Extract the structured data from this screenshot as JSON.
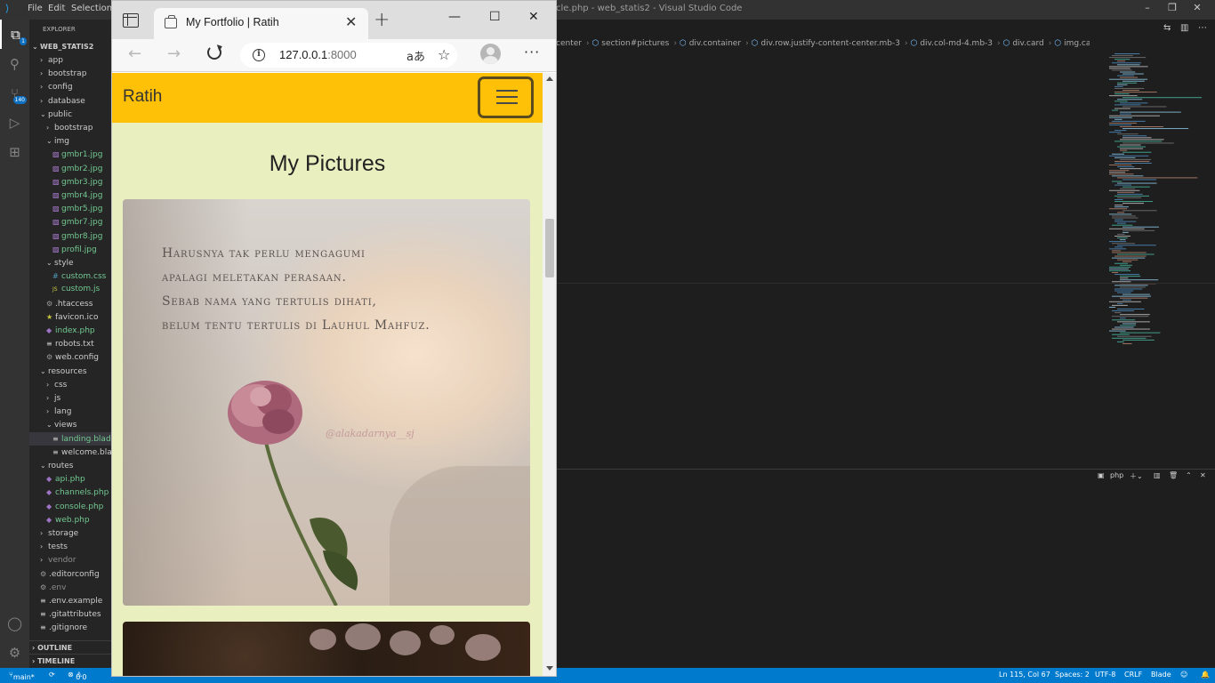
{
  "vscode": {
    "menu": [
      "File",
      "Edit",
      "Selection"
    ],
    "window_title": "cle.php - web_statis2 - Visual Studio Code",
    "explorer_header": "EXPLORER",
    "source_control_badge": "140",
    "explorer_badge": "1",
    "root": "WEB_STATIS2",
    "tree": [
      {
        "label": "app",
        "depth": 1,
        "type": "folder",
        "open": false
      },
      {
        "label": "bootstrap",
        "depth": 1,
        "type": "folder",
        "open": false
      },
      {
        "label": "config",
        "depth": 1,
        "type": "folder",
        "open": false
      },
      {
        "label": "database",
        "depth": 1,
        "type": "folder",
        "open": false
      },
      {
        "label": "public",
        "depth": 1,
        "type": "folder",
        "open": true
      },
      {
        "label": "bootstrap",
        "depth": 2,
        "type": "folder",
        "open": false
      },
      {
        "label": "img",
        "depth": 2,
        "type": "folder",
        "open": true
      },
      {
        "label": "gmbr1.jpg",
        "depth": 3,
        "type": "img"
      },
      {
        "label": "gmbr2.jpg",
        "depth": 3,
        "type": "img"
      },
      {
        "label": "gmbr3.jpg",
        "depth": 3,
        "type": "img"
      },
      {
        "label": "gmbr4.jpg",
        "depth": 3,
        "type": "img"
      },
      {
        "label": "gmbr5.jpg",
        "depth": 3,
        "type": "img"
      },
      {
        "label": "gmbr7.jpg",
        "depth": 3,
        "type": "img"
      },
      {
        "label": "gmbr8.jpg",
        "depth": 3,
        "type": "img"
      },
      {
        "label": "profil.jpg",
        "depth": 3,
        "type": "img"
      },
      {
        "label": "style",
        "depth": 2,
        "type": "folder",
        "open": true
      },
      {
        "label": "custom.css",
        "depth": 3,
        "type": "css"
      },
      {
        "label": "custom.js",
        "depth": 3,
        "type": "js"
      },
      {
        "label": ".htaccess",
        "depth": 2,
        "type": "gear"
      },
      {
        "label": "favicon.ico",
        "depth": 2,
        "type": "star"
      },
      {
        "label": "index.php",
        "depth": 2,
        "type": "php"
      },
      {
        "label": "robots.txt",
        "depth": 2,
        "type": "txt"
      },
      {
        "label": "web.config",
        "depth": 2,
        "type": "gear"
      },
      {
        "label": "resources",
        "depth": 1,
        "type": "folder",
        "open": true
      },
      {
        "label": "css",
        "depth": 2,
        "type": "folder",
        "open": false
      },
      {
        "label": "js",
        "depth": 2,
        "type": "folder",
        "open": false
      },
      {
        "label": "lang",
        "depth": 2,
        "type": "folder",
        "open": false
      },
      {
        "label": "views",
        "depth": 2,
        "type": "folder",
        "open": true
      },
      {
        "label": "landing.blade.",
        "depth": 3,
        "type": "txt",
        "selected": true
      },
      {
        "label": "welcome.blade.",
        "depth": 3,
        "type": "txt"
      },
      {
        "label": "routes",
        "depth": 1,
        "type": "folder",
        "open": true
      },
      {
        "label": "api.php",
        "depth": 2,
        "type": "php"
      },
      {
        "label": "channels.php",
        "depth": 2,
        "type": "php"
      },
      {
        "label": "console.php",
        "depth": 2,
        "type": "php"
      },
      {
        "label": "web.php",
        "depth": 2,
        "type": "php"
      },
      {
        "label": "storage",
        "depth": 1,
        "type": "folder",
        "open": false
      },
      {
        "label": "tests",
        "depth": 1,
        "type": "folder",
        "open": false
      },
      {
        "label": "vendor",
        "depth": 1,
        "type": "folder",
        "open": false,
        "dim": true
      },
      {
        "label": ".editorconfig",
        "depth": 1,
        "type": "gear"
      },
      {
        "label": ".env",
        "depth": 1,
        "type": "gear",
        "dim": true
      },
      {
        "label": ".env.example",
        "depth": 1,
        "type": "txt"
      },
      {
        "label": ".gitattributes",
        "depth": 1,
        "type": "txt"
      },
      {
        "label": ".gitignore",
        "depth": 1,
        "type": "txt"
      }
    ],
    "sections": [
      "OUTLINE",
      "TIMELINE"
    ],
    "breadcrumb": [
      "center",
      "section#pictures",
      "div.container",
      "div.row.justify-content-center.mb-3",
      "div.col-md-4.mb-3",
      "div.card",
      "img.card-img-top"
    ],
    "terminal_shell": "php",
    "status": {
      "branch": "main*",
      "errors": "0",
      "warnings": "0",
      "position": "Ln 115, Col 67",
      "spaces": "Spaces: 2",
      "encoding": "UTF-8",
      "eol": "CRLF",
      "language": "Blade"
    }
  },
  "browser": {
    "tab_title": "My Fortfolio | Ratih",
    "url_host": "127.0.0.1",
    "url_port": ":8000",
    "read_aloud": "aあ"
  },
  "page": {
    "brand": "Ratih",
    "section_title": "My Pictures",
    "card1_quote": [
      "Harusnya tak perlu mengagumi",
      "apalagi meletakan perasaan.",
      "Sebab nama yang tertulis dihati,",
      "belum tentu tertulis di Lauhul Mahfuz."
    ],
    "card1_watermark": "@alakadarnya__sj"
  },
  "colors": {
    "navbar": "#ffc107",
    "page_bg": "#eaefbf",
    "statusbar": "#007acc"
  }
}
